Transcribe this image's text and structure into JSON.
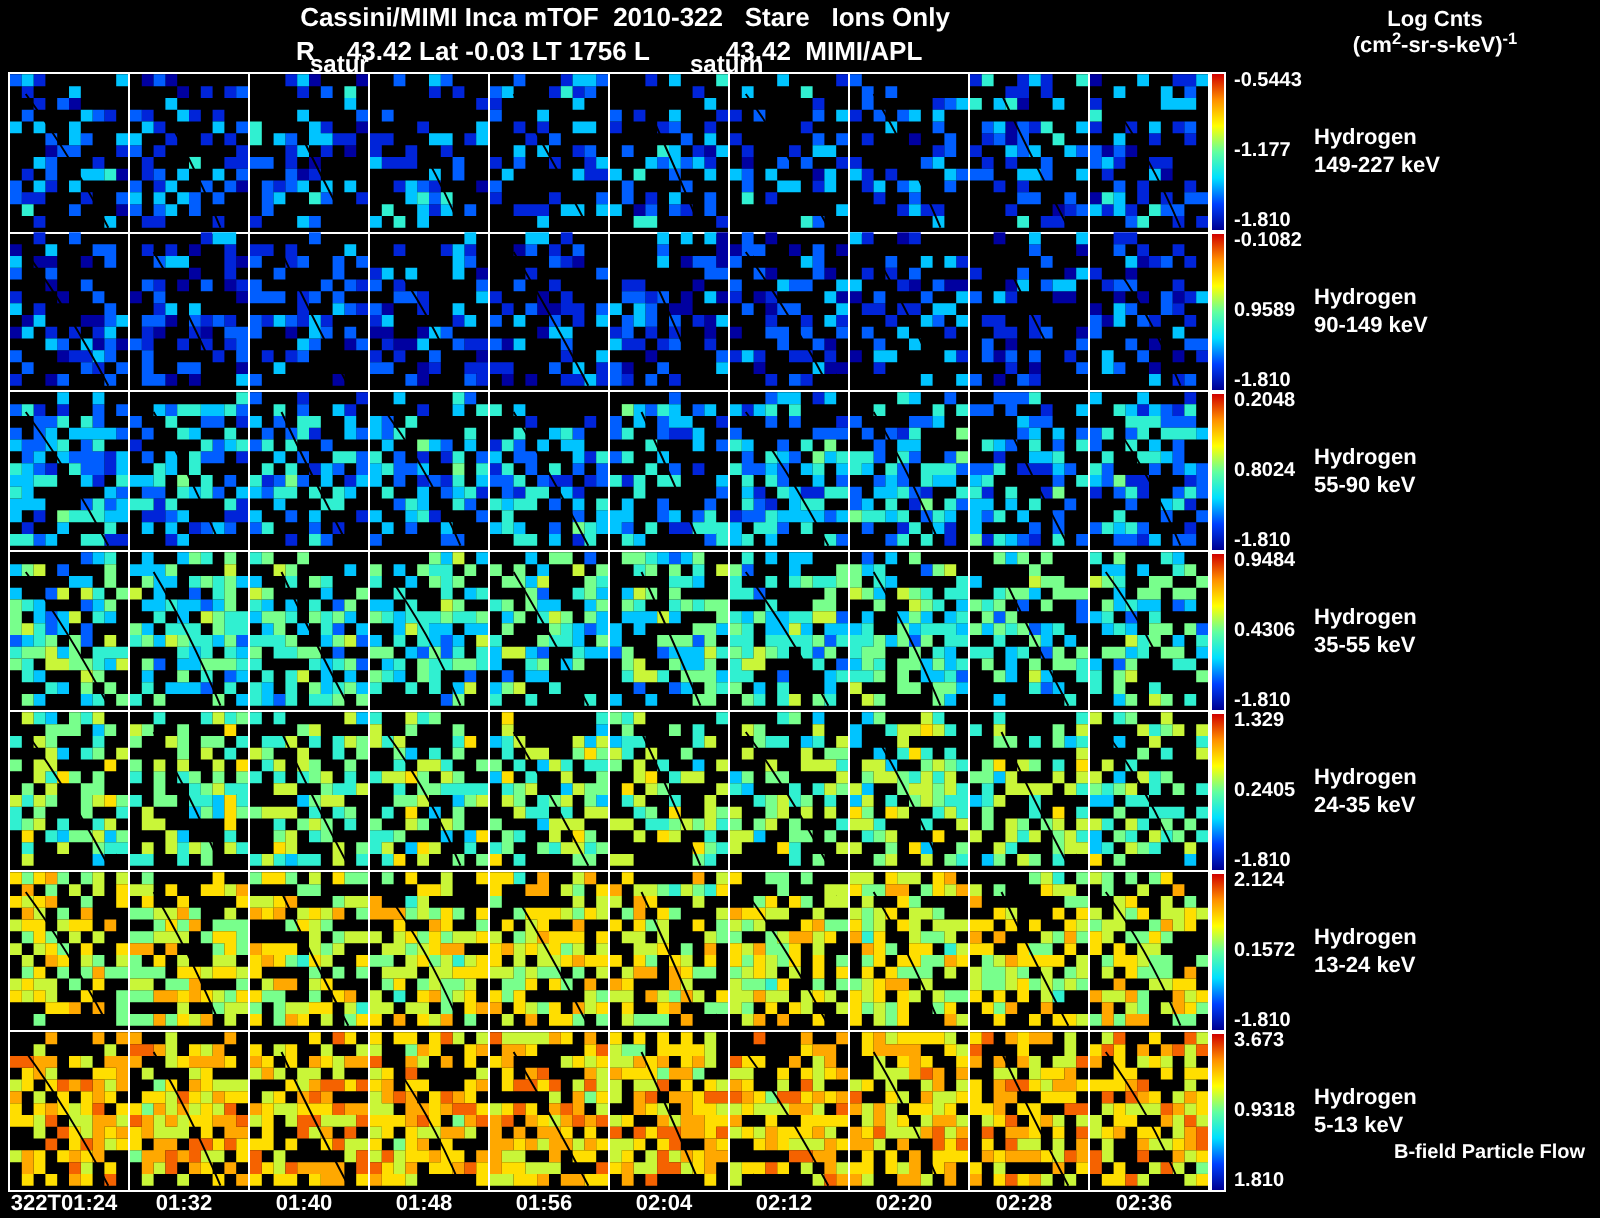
{
  "header": {
    "title": "Cassini/MIMI Inca mTOF  2010-322   Stare   Ions Only",
    "position_label": "R",
    "position": "43.42 Lat -0.03 LT 1756 L",
    "shell": "43.42  MIMI/APL",
    "overlay_left": "satur",
    "overlay_right": "saturn"
  },
  "units": {
    "title": "Log Cnts",
    "unit": "(cm$^{2}$-sr-s-keV)$^{-1}$"
  },
  "channels": [
    {
      "species": "Hydrogen",
      "range": "149-227 keV",
      "max": "-0.5443",
      "mid": "-1.177",
      "min": "-1.810"
    },
    {
      "species": "Hydrogen",
      "range": "90-149 keV",
      "max": "-0.1082",
      "mid": "0.9589",
      "min": "-1.810"
    },
    {
      "species": "Hydrogen",
      "range": "55-90 keV",
      "max": "0.2048",
      "mid": "0.8024",
      "min": "-1.810"
    },
    {
      "species": "Hydrogen",
      "range": "35-55 keV",
      "max": "0.9484",
      "mid": "0.4306",
      "min": "-1.810"
    },
    {
      "species": "Hydrogen",
      "range": "24-35 keV",
      "max": "1.329",
      "mid": "0.2405",
      "min": "-1.810"
    },
    {
      "species": "Hydrogen",
      "range": "13-24 keV",
      "max": "2.124",
      "mid": "0.1572",
      "min": "-1.810"
    },
    {
      "species": "Hydrogen",
      "range": "5-13 keV",
      "max": "3.673",
      "mid": "0.9318",
      "min": "1.810"
    }
  ],
  "times": [
    "322T01:24",
    "01:32",
    "01:40",
    "01:48",
    "01:56",
    "02:04",
    "02:12",
    "02:20",
    "02:28",
    "02:36"
  ],
  "footnote": "B-field Particle Flow"
}
